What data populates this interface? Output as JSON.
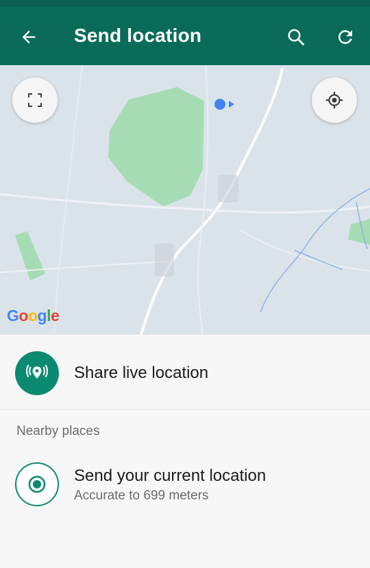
{
  "header": {
    "title": "Send location",
    "back_icon": "arrow-left-icon",
    "search_icon": "search-icon",
    "refresh_icon": "refresh-icon",
    "background_color": "#0b6b5b"
  },
  "map": {
    "attribution": "Google",
    "fullscreen_icon": "fullscreen-icon",
    "my_location_icon": "crosshair-icon",
    "location_marker_icon": "current-position-dot-icon"
  },
  "live_location": {
    "label": "Share live location",
    "icon": "live-location-pin-icon",
    "accent_color": "#0b8a72"
  },
  "nearby": {
    "header": "Nearby places",
    "current_location": {
      "title": "Send your current location",
      "subtitle": "Accurate to 699 meters",
      "icon": "radio-target-icon"
    }
  }
}
